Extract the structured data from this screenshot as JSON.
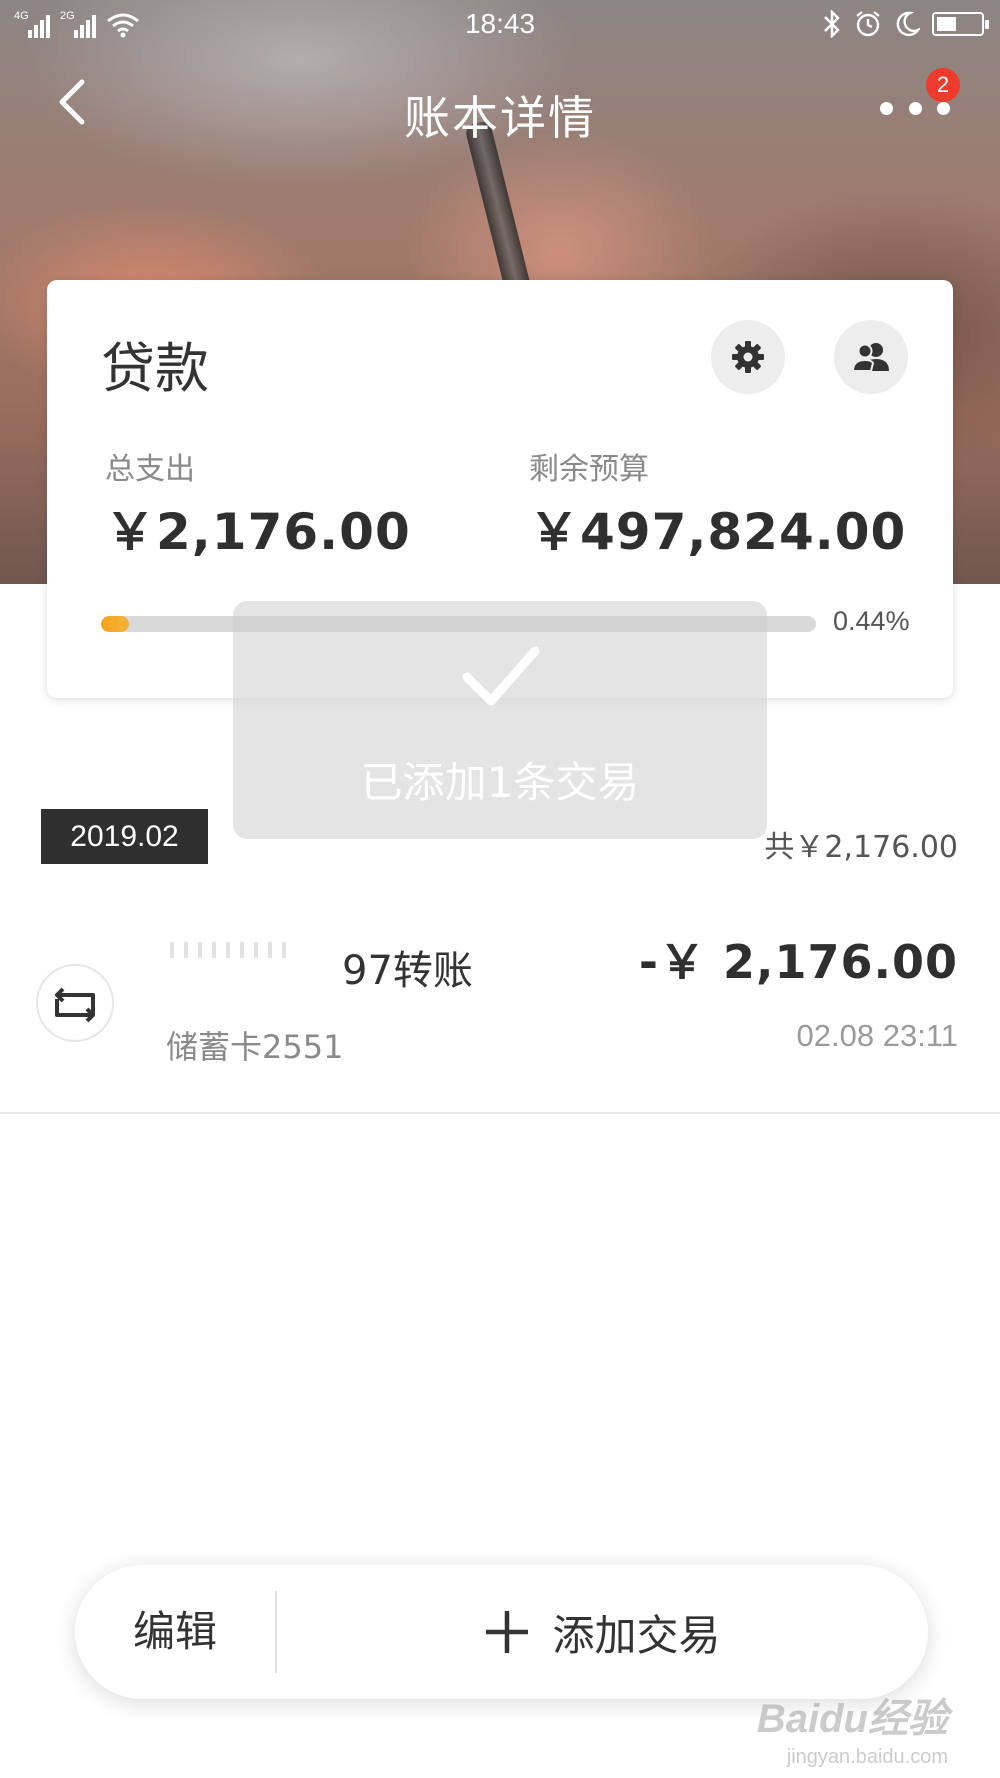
{
  "status_bar": {
    "time": "18:43",
    "network_1": "4G",
    "network_2": "2G",
    "battery_level": 0.45
  },
  "nav": {
    "title": "账本详情",
    "badge_count": "2",
    "icons": [
      "back-arrow-icon",
      "more-dots-icon"
    ]
  },
  "budget": {
    "title": "贷款",
    "spent_label": "总支出",
    "spent_value": "￥2,176.00",
    "remaining_label": "剩余预算",
    "remaining_value": "￥497,824.00",
    "progress_fraction": 0.0044,
    "progress_text": "0.44%",
    "icons": [
      "gear-icon",
      "members-icon"
    ]
  },
  "toast": {
    "message": "已添加1条交易"
  },
  "month": {
    "label": "2019.02",
    "total": "共￥2,176.00"
  },
  "transactions": [
    {
      "name": "97转账",
      "account": "储蓄卡2551",
      "amount": "-￥ 2,176.00",
      "time": "02.08 23:11",
      "icon": "transfer-icon"
    }
  ],
  "bottom_bar": {
    "edit_label": "编辑",
    "add_label": "添加交易"
  },
  "watermark": {
    "main": "Baidu经验",
    "sub": "jingyan.baidu.com"
  },
  "colors": {
    "accent": "#f7a21b",
    "badge": "#ee3b2b",
    "dark_tag": "#2f2f2f"
  }
}
